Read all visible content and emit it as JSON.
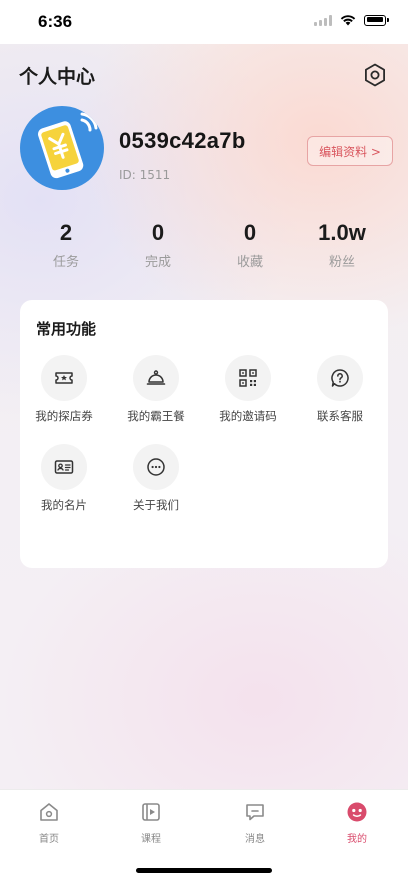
{
  "status_bar": {
    "time": "6:36"
  },
  "header": {
    "title": "个人中心"
  },
  "profile": {
    "username": "0539c42a7b",
    "id_text": "ID: 1511",
    "edit_label": "编辑资料 >"
  },
  "stats": [
    {
      "value": "2",
      "label": "任务"
    },
    {
      "value": "0",
      "label": "完成"
    },
    {
      "value": "0",
      "label": "收藏"
    },
    {
      "value": "1.0w",
      "label": "粉丝"
    }
  ],
  "features": {
    "title": "常用功能",
    "items": [
      {
        "label": "我的探店券",
        "icon": "coupon-icon"
      },
      {
        "label": "我的霸王餐",
        "icon": "dish-cover-icon"
      },
      {
        "label": "我的邀请码",
        "icon": "qr-code-icon"
      },
      {
        "label": "联系客服",
        "icon": "help-icon"
      },
      {
        "label": "我的名片",
        "icon": "card-icon"
      },
      {
        "label": "关于我们",
        "icon": "chat-dots-icon"
      }
    ]
  },
  "tab_bar": {
    "items": [
      {
        "label": "首页",
        "icon": "home-icon",
        "active": false
      },
      {
        "label": "课程",
        "icon": "course-icon",
        "active": false
      },
      {
        "label": "消息",
        "icon": "message-icon",
        "active": false
      },
      {
        "label": "我的",
        "icon": "profile-face-icon",
        "active": true
      }
    ]
  },
  "colors": {
    "accent": "#d94b6c",
    "avatar_blue": "#3d8fe0",
    "avatar_yellow": "#f6d33c"
  }
}
